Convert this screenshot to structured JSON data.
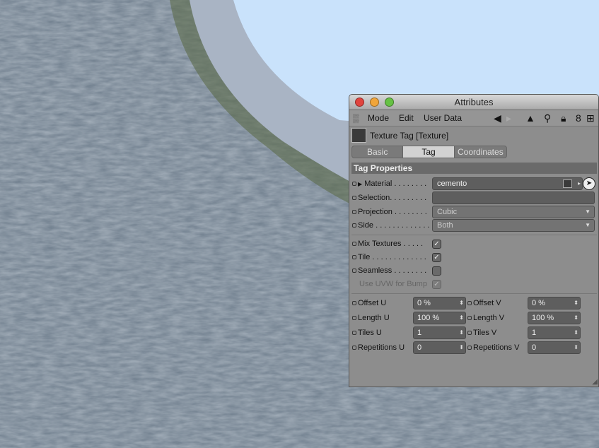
{
  "window": {
    "title": "Attributes"
  },
  "menu": {
    "items": [
      "Mode",
      "Edit",
      "User Data"
    ]
  },
  "object": {
    "title": "Texture Tag [Texture]"
  },
  "tabs": [
    "Basic",
    "Tag",
    "Coordinates"
  ],
  "active_tab": "Tag",
  "section": "Tag Properties",
  "fields": {
    "material": {
      "label": "Material",
      "value": "cemento"
    },
    "selection": {
      "label": "Selection",
      "value": ""
    },
    "projection": {
      "label": "Projection",
      "value": "Cubic"
    },
    "side": {
      "label": "Side",
      "value": "Both"
    }
  },
  "checks": [
    {
      "label": "Mix Textures",
      "checked": true,
      "enabled": true
    },
    {
      "label": "Tile",
      "checked": true,
      "enabled": true
    },
    {
      "label": "Seamless",
      "checked": false,
      "enabled": true
    },
    {
      "label": "Use UVW for Bump",
      "checked": true,
      "enabled": false
    }
  ],
  "grid": [
    {
      "u_label": "Offset U",
      "u_value": "0 %",
      "v_label": "Offset V",
      "v_value": "0 %"
    },
    {
      "u_label": "Length U",
      "u_value": "100 %",
      "v_label": "Length V",
      "v_value": "100 %"
    },
    {
      "u_label": "Tiles U",
      "u_value": "1",
      "v_label": "Tiles V",
      "v_value": "1"
    },
    {
      "u_label": "Repetitions U",
      "u_value": "0",
      "v_label": "Repetitions V",
      "v_value": "0"
    }
  ],
  "colors": {
    "viewport_ground": "#6e7d8c",
    "viewport_sky": "#c9e2fb",
    "panel": "#8d8d8d"
  }
}
